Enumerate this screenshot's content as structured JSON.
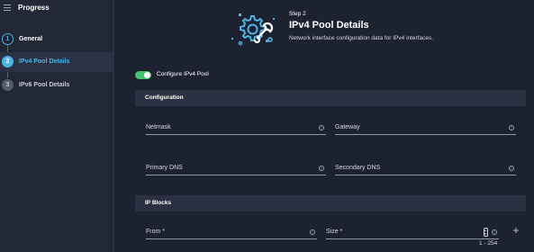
{
  "sidebar": {
    "title": "Progress",
    "menu_icon": "hamburger-icon",
    "steps": [
      {
        "number": "1",
        "label": "General",
        "state": "done"
      },
      {
        "number": "2",
        "label": "IPv4 Pool Details",
        "state": "current"
      },
      {
        "number": "3",
        "label": "IPv6 Pool Details",
        "state": "pending"
      }
    ]
  },
  "header": {
    "icon": "gear-wrench-icon",
    "step": "Step 2",
    "title": "IPv4 Pool Details",
    "description": "Network interface configuration data for IPv4 interfaces."
  },
  "toggle": {
    "label": "Configure IPv4 Pool",
    "on": true
  },
  "configuration": {
    "title": "Configuration",
    "netmask": "Netmask",
    "gateway": "Gateway",
    "primary_dns": "Primary DNS",
    "secondary_dns": "Secondary DNS"
  },
  "ip_blocks": {
    "title": "IP Blocks",
    "from": "From *",
    "size": "Size *",
    "size_range": "1 - 254",
    "add_icon": "plus-icon"
  },
  "colors": {
    "accent": "#4fb3e6",
    "toggle_on": "#44c26d",
    "background": "#1d2230"
  }
}
